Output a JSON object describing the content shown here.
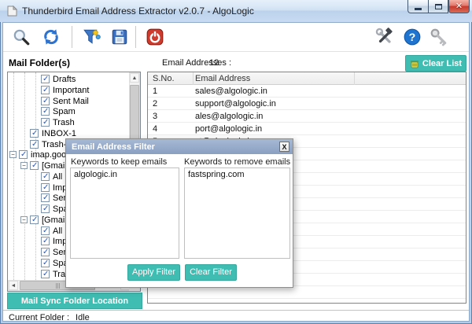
{
  "window": {
    "title": "Thunderbird Email Address Extractor v2.0.7 - AlgoLogic"
  },
  "toolbar": {
    "left_icons": [
      "search",
      "refresh",
      "filter",
      "save",
      "exit"
    ],
    "right_icons": [
      "tools",
      "help",
      "license-key"
    ]
  },
  "header": {
    "mail_folders_label": "Mail Folder(s)",
    "email_count_label": "Email Addresses :",
    "email_count": "12",
    "clear_list_label": "Clear List"
  },
  "tree": {
    "items": [
      {
        "label": "Drafts",
        "level": 3,
        "checked": true,
        "expandable": false
      },
      {
        "label": "Important",
        "level": 3,
        "checked": true,
        "expandable": false
      },
      {
        "label": "Sent Mail",
        "level": 3,
        "checked": true,
        "expandable": false
      },
      {
        "label": "Spam",
        "level": 3,
        "checked": true,
        "expandable": false
      },
      {
        "label": "Trash",
        "level": 3,
        "checked": true,
        "expandable": false
      },
      {
        "label": "INBOX-1",
        "level": 2,
        "checked": true,
        "expandable": false
      },
      {
        "label": "Trash-1",
        "level": 2,
        "checked": true,
        "expandable": false
      },
      {
        "label": "imap.google.com",
        "level": 1,
        "checked": true,
        "expandable": true
      },
      {
        "label": "[Gmail]",
        "level": 2,
        "checked": true,
        "expandable": true
      },
      {
        "label": "All Mail",
        "level": 3,
        "checked": true,
        "expandable": false
      },
      {
        "label": "Important",
        "level": 3,
        "checked": true,
        "expandable": false
      },
      {
        "label": "Sent Mail",
        "level": 3,
        "checked": true,
        "expandable": false
      },
      {
        "label": "Spam",
        "level": 3,
        "checked": true,
        "expandable": false
      },
      {
        "label": "[Gmail]",
        "level": 2,
        "checked": true,
        "expandable": true
      },
      {
        "label": "All Mail",
        "level": 3,
        "checked": true,
        "expandable": false
      },
      {
        "label": "Important",
        "level": 3,
        "checked": true,
        "expandable": false
      },
      {
        "label": "Sent Mail",
        "level": 3,
        "checked": true,
        "expandable": false
      },
      {
        "label": "Spam",
        "level": 3,
        "checked": true,
        "expandable": false
      },
      {
        "label": "Trash",
        "level": 3,
        "checked": true,
        "expandable": false
      }
    ]
  },
  "table": {
    "columns": [
      "S.No.",
      "Email Address"
    ],
    "rows": [
      {
        "sno": "1",
        "email": "sales@algologic.in"
      },
      {
        "sno": "2",
        "email": "support@algologic.in"
      },
      {
        "sno": "3",
        "email": "ales@algologic.in"
      },
      {
        "sno": "4",
        "email": "port@algologic.in"
      },
      {
        "sno": "5",
        "email": "st@algologic.in"
      }
    ]
  },
  "filter_dialog": {
    "title": "Email Address Filter",
    "close_glyph": "X",
    "keep_label": "Keywords to keep emails",
    "remove_label": "Keywords to remove emails",
    "keep_value": "algologic.in",
    "remove_value": "fastspring.com",
    "apply_button": "Apply Filter",
    "clear_button": "Clear Filter"
  },
  "footer": {
    "sync_button": "Mail Sync Folder Location",
    "status_label": "Current Folder :",
    "status_value": "Idle"
  },
  "colors": {
    "accent_teal": "#3fbdb2",
    "dialog_header": "#93a9c9",
    "close_button_red": "#c8473c",
    "titlebar_blue": "#c6daf1"
  }
}
